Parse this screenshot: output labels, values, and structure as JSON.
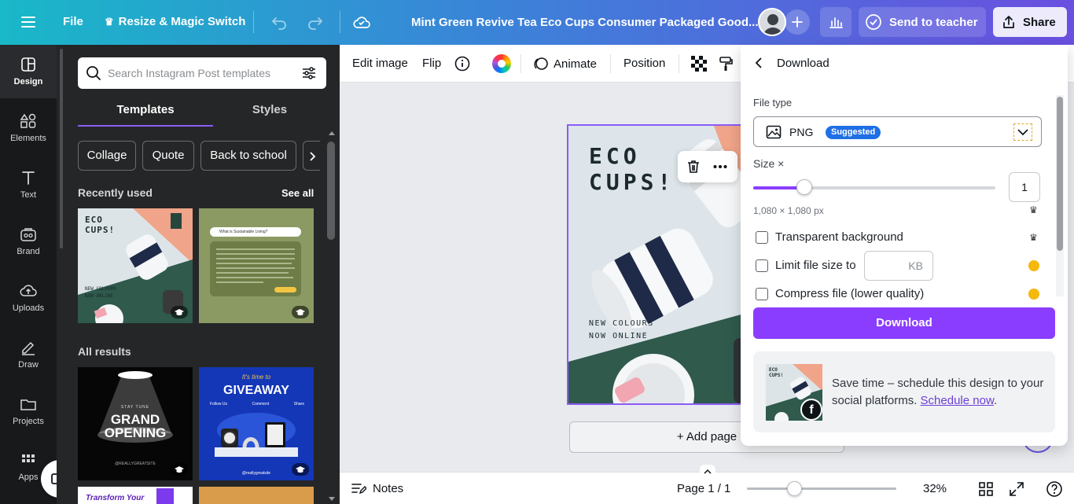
{
  "topbar": {
    "menu_icon": "hamburger-icon",
    "file_label": "File",
    "resize_label": "Resize & Magic Switch",
    "doc_title": "Mint Green Revive Tea Eco Cups Consumer Packaged Good...",
    "send_label": "Send to teacher",
    "share_label": "Share"
  },
  "rail": {
    "items": [
      {
        "label": "Design",
        "icon": "design-icon"
      },
      {
        "label": "Elements",
        "icon": "elements-icon"
      },
      {
        "label": "Text",
        "icon": "text-icon"
      },
      {
        "label": "Brand",
        "icon": "brand-icon"
      },
      {
        "label": "Uploads",
        "icon": "uploads-icon"
      },
      {
        "label": "Draw",
        "icon": "draw-icon"
      },
      {
        "label": "Projects",
        "icon": "projects-icon"
      },
      {
        "label": "Apps",
        "icon": "apps-icon"
      }
    ]
  },
  "panel": {
    "search_placeholder": "Search Instagram Post templates",
    "tabs": [
      "Templates",
      "Styles"
    ],
    "chips": [
      "Collage",
      "Quote",
      "Back to school"
    ],
    "recently_used": "Recently used",
    "see_all": "See all",
    "all_results": "All results",
    "thumbs": {
      "eco_title": "ECO\nCUPS!",
      "eco_sub": "NEW COLOURS\nNOW ONLINE",
      "sustain_title": "What is Sustainable Living?",
      "grand_small": "STAY TUNE",
      "grand_title": "GRAND\nOPENING",
      "grand_site": "@REALLYGREATSITE",
      "giveaway_small": "It's time to",
      "giveaway_title": "GIVEAWAY",
      "giveaway_steps": [
        "Follow Us",
        "Comment",
        "Share"
      ],
      "giveaway_site": "@reallygreatsite",
      "transform": "Transform Your"
    }
  },
  "toolbar": {
    "edit_image": "Edit image",
    "flip": "Flip",
    "animate": "Animate",
    "position": "Position"
  },
  "design": {
    "title_line1": "ECO",
    "title_line2": "CUPS!",
    "sub_line1": "NEW COLOURS",
    "sub_line2": "NOW ONLINE"
  },
  "canvas": {
    "add_page": "+ Add page"
  },
  "bottombar": {
    "notes": "Notes",
    "page": "Page 1 / 1",
    "zoom": "32%",
    "zoom_level": 0.32
  },
  "download": {
    "title": "Download",
    "file_type_label": "File type",
    "file_type": "PNG",
    "suggested": "Suggested",
    "size_label": "Size ×",
    "size_value": "1",
    "size_fraction": 0.21,
    "dimensions": "1,080 × 1,080 px",
    "transparent": "Transparent background",
    "limit": "Limit file size to",
    "kb": "KB",
    "compress": "Compress file (lower quality)",
    "button": "Download",
    "promo_text": "Save time – schedule this design to your social platforms.",
    "promo_link": "Schedule now",
    "promo_end": "."
  },
  "colors": {
    "accent": "#8b3dff",
    "selection": "#8b5cf6",
    "badge_blue": "#1f6fe5"
  }
}
